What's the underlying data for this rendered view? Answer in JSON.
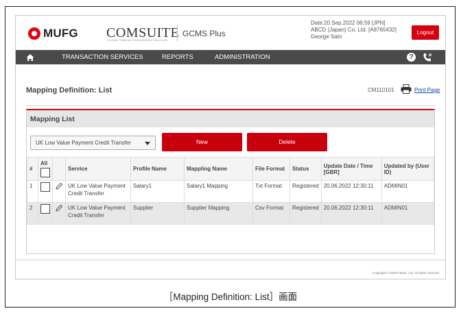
{
  "brand": {
    "bank": "MUFG",
    "product": "COMSUITE",
    "product_sub": "GLOBAL TRANSACTION BANKING SOLUTION",
    "module": "GCMS Plus"
  },
  "user_info": {
    "date": "Date:20.Sep.2022 06:59 [JPN]",
    "company": "ABCD (Japan) Co. Ltd. [A8765432]",
    "user": "George Sato"
  },
  "header": {
    "logout_label": "Logout"
  },
  "nav": {
    "items": [
      "TRANSACTION SERVICES",
      "REPORTS",
      "ADMINISTRATION"
    ],
    "help_label": "?"
  },
  "page": {
    "title": "Mapping Definition: List",
    "screen_id": "CM110101",
    "print_label": "Print Page"
  },
  "panel": {
    "title": "Mapping List",
    "service_select": {
      "selected": "UK Low Value Payment Credit Transfer"
    },
    "new_label": "New",
    "delete_label": "Delete"
  },
  "table": {
    "headers": {
      "num": "#",
      "all": "All",
      "service": "Service",
      "profile": "Profile Name",
      "mapping": "Mappling Name",
      "format": "File Format",
      "status": "Status",
      "update": "Update Date / Time [GBR]",
      "updated_by": "Updated by (User ID)"
    },
    "rows": [
      {
        "num": "1",
        "service": "UK Low Value Payment Credit Transfer",
        "profile": "Salary1",
        "mapping": "Salary1 Mapping",
        "format": "Txt Format",
        "status": "Registered",
        "update": "20.06.2022 12:30:11",
        "updated_by": "ADMIN01"
      },
      {
        "num": "2",
        "service": "UK Low Value Payment Credit Transfer",
        "profile": "Supplier",
        "mapping": "Supplier Mapping",
        "format": "Csv Format",
        "status": "Registered",
        "update": "20.06.2022 12:30:11",
        "updated_by": "ADMIN01"
      }
    ]
  },
  "footer": {
    "copyright": "Copyright © MUFG Bank, Ltd. All rights reserved."
  },
  "caption": "［Mapping Definition: List］画面",
  "colors": {
    "accent": "#d40010",
    "nav": "#4a4a4a"
  }
}
